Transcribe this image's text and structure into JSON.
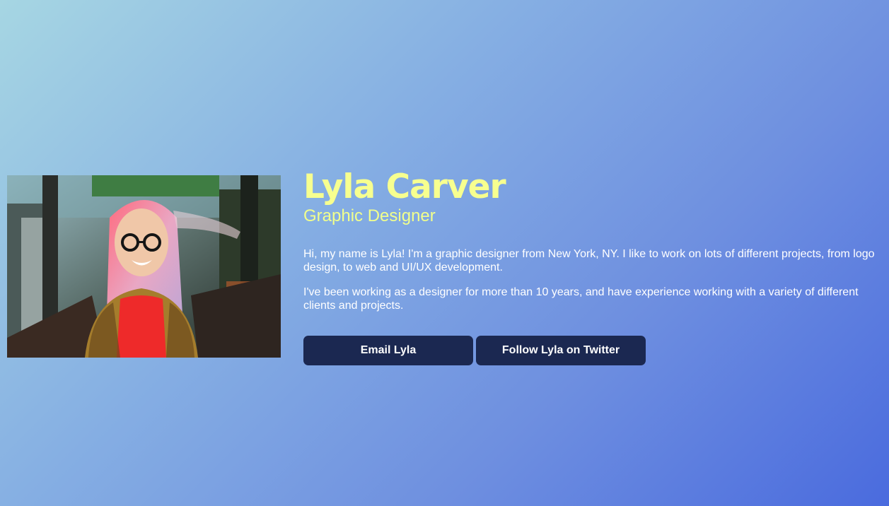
{
  "profile": {
    "name": "Lyla Carver",
    "role": "Graphic Designer",
    "bio": [
      "Hi, my name is Lyla! I'm a graphic designer from New York, NY. I like to work on lots of different projects, from logo design, to web and UI/UX development.",
      "I've been working as a designer for more than 10 years, and have experience working with a variety of different clients and projects."
    ]
  },
  "actions": {
    "email_label": "Email Lyla",
    "twitter_label": "Follow Lyla on Twitter"
  },
  "colors": {
    "accent": "#f7ff8f",
    "button": "#1b2851",
    "background_start": "#a6d6e3",
    "background_end": "#4a6bde"
  }
}
